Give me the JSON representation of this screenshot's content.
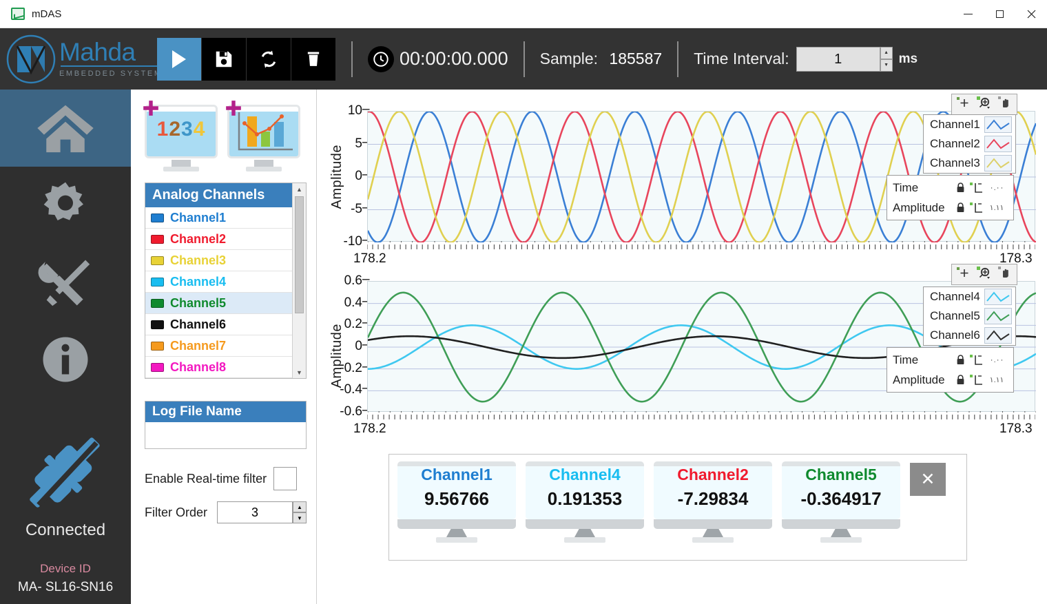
{
  "window": {
    "title": "mDAS",
    "app_icon": "chart-app-icon",
    "minimize": "—",
    "maximize": "□",
    "close": "✕"
  },
  "brand": {
    "name": "Mahda",
    "subtitle": "EMBEDDED SYSTEMS"
  },
  "toolbar": {
    "play_label": "play-button",
    "save_label": "save-button",
    "refresh_label": "↻",
    "delete_label": "delete-button",
    "clock_icon": "clock-icon",
    "elapsed_time": "00:00:00.000",
    "sample_label": "Sample:",
    "sample_value": "185587",
    "interval_label": "Time Interval:",
    "interval_value": "1",
    "interval_unit": "ms",
    "spin_up": "▲",
    "spin_down": "▼"
  },
  "sidebar": {
    "items": [
      {
        "name": "home",
        "icon": "home-icon",
        "active": true
      },
      {
        "name": "settings",
        "icon": "gear-icon",
        "active": false
      },
      {
        "name": "tools",
        "icon": "tools-icon",
        "active": false
      },
      {
        "name": "info",
        "icon": "info-icon",
        "active": false
      }
    ],
    "status": {
      "icon": "plug-connected-icon",
      "text": "Connected",
      "device_id_label": "Device ID",
      "device_id_value": "MA- SL16-SN16",
      "accent": "#4a92c4"
    }
  },
  "panel": {
    "monitor_numeric": {
      "name": "numeric-display-button",
      "digits": [
        "1",
        "2",
        "3",
        "4"
      ],
      "digit_colors": [
        "#e8583c",
        "#a7672c",
        "#3f96c9",
        "#f0c63a"
      ],
      "plus": "+"
    },
    "monitor_chart": {
      "name": "chart-display-button",
      "plus": "+"
    },
    "channels": {
      "header": "Analog Channels",
      "items": [
        {
          "label": "Channel1",
          "color": "#1f7ed0",
          "selected": false
        },
        {
          "label": "Channel2",
          "color": "#f01b2e",
          "selected": false
        },
        {
          "label": "Channel3",
          "color": "#e8d236",
          "selected": false
        },
        {
          "label": "Channel4",
          "color": "#19bdf0",
          "selected": false
        },
        {
          "label": "Channel5",
          "color": "#0f8a2e",
          "selected": true
        },
        {
          "label": "Channel6",
          "color": "#111111",
          "selected": false
        },
        {
          "label": "Channel7",
          "color": "#f59a1e",
          "selected": false
        },
        {
          "label": "Channel8",
          "color": "#f318c0",
          "selected": false
        }
      ],
      "scroll_up": "▲",
      "scroll_down": "▼"
    },
    "log": {
      "header": "Log File Name",
      "value": "",
      "placeholder": ""
    },
    "filter": {
      "enable_label": "Enable Real-time filter",
      "enable_checked": false,
      "order_label": "Filter Order",
      "order_value": "3",
      "spin_up": "▲",
      "spin_down": "▼"
    }
  },
  "charts": [
    {
      "id": "chart-top",
      "tools": [
        "crosshair-icon",
        "zoom-icon",
        "pan-icon"
      ],
      "legend": [
        {
          "label": "Channel1",
          "color": "#3a7fd5"
        },
        {
          "label": "Channel2",
          "color": "#e8455c"
        },
        {
          "label": "Channel3",
          "color": "#ddd06a"
        }
      ],
      "scale_rows": [
        {
          "label": "Time",
          "lock": "lock-closed-icon",
          "axis": "x-axis-icon",
          "format": "۰.۰۰"
        },
        {
          "label": "Amplitude",
          "lock": "lock-closed-icon",
          "axis": "y-axis-icon",
          "format": "۱.۱۱"
        }
      ]
    },
    {
      "id": "chart-bottom",
      "tools": [
        "crosshair-icon",
        "zoom-icon",
        "pan-icon"
      ],
      "legend": [
        {
          "label": "Channel4",
          "color": "#3fc8f0"
        },
        {
          "label": "Channel5",
          "color": "#3f9e56"
        },
        {
          "label": "Channel6",
          "color": "#303030"
        }
      ],
      "scale_rows": [
        {
          "label": "Time",
          "lock": "lock-closed-icon",
          "axis": "x-axis-icon",
          "format": "۰.۰۰"
        },
        {
          "label": "Amplitude",
          "lock": "lock-closed-icon",
          "axis": "y-axis-icon",
          "format": "۱.۱۱"
        }
      ]
    }
  ],
  "chart_data": [
    {
      "type": "line",
      "id": "chart-top",
      "title": "",
      "xlabel": "",
      "ylabel": "Amplitude",
      "xlim": [
        178.2,
        178.3
      ],
      "xticklabels": [
        "178.2",
        "178.3"
      ],
      "ylim": [
        -10,
        10
      ],
      "yticklabels": [
        "10",
        "5",
        "0",
        "-5",
        "-10"
      ],
      "yticks": [
        10,
        5,
        0,
        -5,
        -10
      ],
      "grid": true,
      "legend_position": "top-right",
      "series": [
        {
          "name": "Channel1",
          "color": "#3a7fd5",
          "amplitude": 10,
          "cycles": 6.5,
          "phase_deg": -125,
          "offset": 0
        },
        {
          "name": "Channel2",
          "color": "#e8455c",
          "amplitude": 10,
          "cycles": 6.5,
          "phase_deg": 85,
          "offset": 0
        },
        {
          "name": "Channel3",
          "color": "#e0d050",
          "amplitude": 10,
          "cycles": 6.5,
          "phase_deg": -20,
          "offset": 0
        }
      ]
    },
    {
      "type": "line",
      "id": "chart-bottom",
      "title": "",
      "xlabel": "",
      "ylabel": "Amplitude",
      "xlim": [
        178.2,
        178.3
      ],
      "xticklabels": [
        "178.2",
        "178.3"
      ],
      "ylim": [
        -0.6,
        0.6
      ],
      "yticklabels": [
        "0.6",
        "0.4",
        "0.2",
        "0",
        "-0.2",
        "-0.4",
        "-0.6"
      ],
      "yticks": [
        0.6,
        0.4,
        0.2,
        0,
        -0.2,
        -0.4,
        -0.6
      ],
      "grid": true,
      "legend_position": "top-right",
      "series": [
        {
          "name": "Channel4",
          "color": "#3fc8f0",
          "amplitude": 0.2,
          "cycles": 3.2,
          "phase_deg": -90,
          "offset": 0
        },
        {
          "name": "Channel5",
          "color": "#3f9e56",
          "amplitude": 0.5,
          "cycles": 4.2,
          "phase_deg": 10,
          "offset": 0
        },
        {
          "name": "Channel6",
          "color": "#202020",
          "amplitude": 0.1,
          "cycles": 2.2,
          "phase_deg": 40,
          "offset": 0
        }
      ]
    }
  ],
  "value_cards": {
    "close_label": "✕",
    "items": [
      {
        "title": "Channel1",
        "value": "9.56766",
        "color": "#1f7ed0"
      },
      {
        "title": "Channel4",
        "value": "0.191353",
        "color": "#19bdf0"
      },
      {
        "title": "Channel2",
        "value": "-7.29834",
        "color": "#f01b2e"
      },
      {
        "title": "Channel5",
        "value": "-0.364917",
        "color": "#0f8a2e"
      }
    ]
  }
}
